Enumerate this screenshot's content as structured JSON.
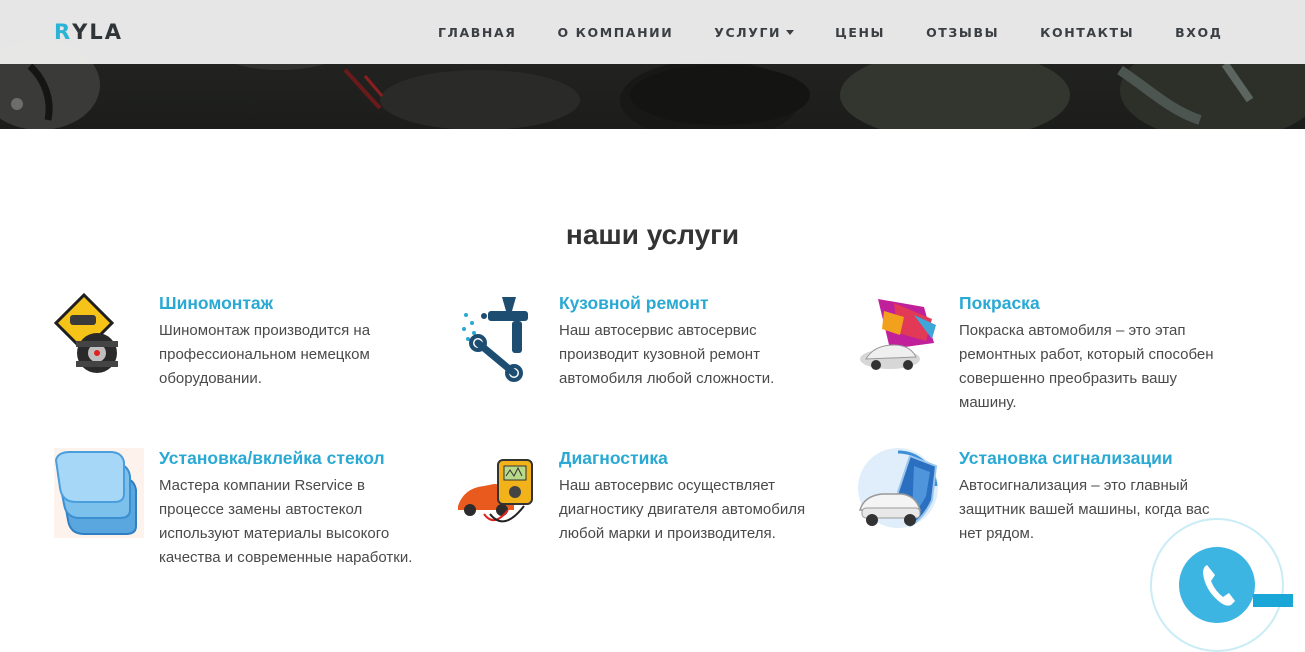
{
  "brand": {
    "logo_r": "R",
    "logo_rest": "YLA",
    "accent": "#29b3d6"
  },
  "nav": {
    "home": "ГЛАВНАЯ",
    "about": "О КОМПАНИИ",
    "services": "УСЛУГИ",
    "prices": "ЦЕНЫ",
    "reviews": "ОТЗЫВЫ",
    "contacts": "КОНТАКТЫ",
    "login": "ВХОД"
  },
  "section": {
    "title": "наши услуги"
  },
  "services": [
    {
      "title": "Шиномонтаж",
      "text": "Шиномонтаж производится на профессиональном немецком оборудовании.",
      "icon": "tire-service-icon"
    },
    {
      "title": "Кузовной ремонт",
      "text": "Наш автосервис автосервис производит кузовной ремонт автомобиля любой сложности.",
      "icon": "spray-gun-wrench-icon"
    },
    {
      "title": "Покраска",
      "text": "Покраска автомобиля – это этап ремонтных работ, который способен совершенно преобразить вашу машину.",
      "icon": "car-paint-icon"
    },
    {
      "title": "Установка/вклейка стекол",
      "text": "Мастера компании Rservice в процессе замены автостекол используют материалы высокого качества и современные наработки.",
      "icon": "glass-panes-icon"
    },
    {
      "title": "Диагностика",
      "text": "Наш автосервис осуществляет диагностику двигателя автомобиля любой марки и производителя.",
      "icon": "car-diagnostic-icon"
    },
    {
      "title": "Установка сигнализации",
      "text": "Автосигнализация – это главный защитник вашей машины, когда вас нет рядом.",
      "icon": "car-alarm-shield-icon"
    }
  ],
  "colors": {
    "title_blue": "#29a9d3",
    "call_button": "#3db5e3"
  }
}
